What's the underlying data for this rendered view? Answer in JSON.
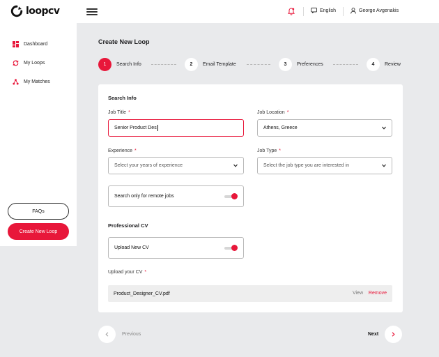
{
  "app": {
    "logo_text": "loopcv"
  },
  "header": {
    "notification_icon": "bell-icon",
    "language": "English",
    "user_name": "George Avgenakis"
  },
  "sidebar": {
    "items": [
      {
        "label": "Dashboard",
        "icon": "dashboard-icon"
      },
      {
        "label": "My Loops",
        "icon": "loop-icon"
      },
      {
        "label": "My Matches",
        "icon": "matches-icon"
      }
    ],
    "faq_label": "FAQs",
    "create_label": "Create New Loop"
  },
  "main": {
    "title": "Create New Loop",
    "steps": [
      {
        "number": "1",
        "label": "Search Info",
        "active": true
      },
      {
        "number": "2",
        "label": "Email Template",
        "active": false
      },
      {
        "number": "3",
        "label": "Preferences",
        "active": false
      },
      {
        "number": "4",
        "label": "Review",
        "active": false
      }
    ],
    "form": {
      "section_search": "Search Info",
      "job_title_label": "Job Title",
      "job_title_value": "Senior Product Des",
      "job_location_label": "Job Location",
      "job_location_value": "Athens, Greece",
      "experience_label": "Experience",
      "experience_placeholder": "Select your years of experience",
      "job_type_label": "Job Type",
      "job_type_placeholder": "Select the job type you are interested in",
      "remote_label": "Search only for remote jobs",
      "remote_on": true,
      "section_cv": "Professional CV",
      "upload_new_label": "Upload New CV",
      "upload_new_on": true,
      "upload_cv_label": "Upload your CV",
      "cv_filename": "Product_Designer_CV.pdf",
      "view_label": "View",
      "remove_label": "Remove",
      "required_mark": "*"
    },
    "pager": {
      "previous": "Previous",
      "next": "Next"
    }
  },
  "colors": {
    "accent": "#e8173a",
    "background": "#e9eaec"
  }
}
